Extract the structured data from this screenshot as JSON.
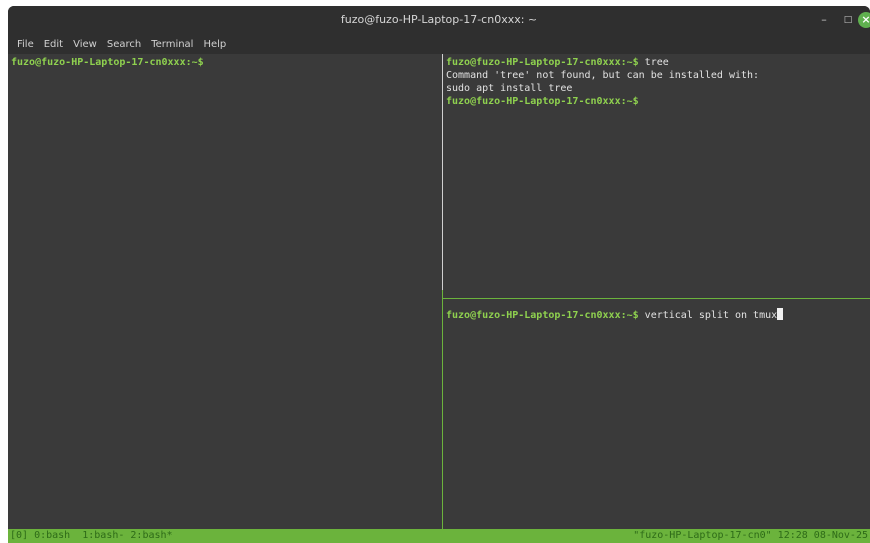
{
  "window": {
    "title": "fuzo@fuzo-HP-Laptop-17-cn0xxx: ~",
    "minimize_label": "–",
    "maximize_label": "□",
    "close_label": "×"
  },
  "menu": [
    "File",
    "Edit",
    "View",
    "Search",
    "Terminal",
    "Help"
  ],
  "panes": {
    "left": {
      "prompt": "fuzo@fuzo-HP-Laptop-17-cn0xxx:~$"
    },
    "top_right": {
      "prompt1": "fuzo@fuzo-HP-Laptop-17-cn0xxx:~$",
      "cmd1": " tree",
      "out1": "Command 'tree' not found, but can be installed with:",
      "out2": "sudo apt install tree",
      "prompt2": "fuzo@fuzo-HP-Laptop-17-cn0xxx:~$"
    },
    "bottom_right": {
      "prompt": "fuzo@fuzo-HP-Laptop-17-cn0xxx:~$",
      "input": " vertical split on tmux"
    }
  },
  "status": {
    "left": "[0] 0:bash  1:bash- 2:bash*",
    "right": "\"fuzo-HP-Laptop-17-cn0\" 12:28 08-Nov-25"
  },
  "colors": {
    "prompt": "#8fd14f",
    "status_bg": "#6bb33c",
    "terminal_bg": "#3a3a3a"
  }
}
